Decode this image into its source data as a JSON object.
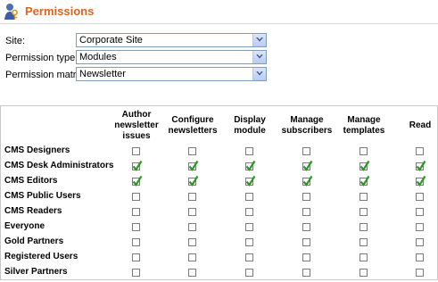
{
  "header": {
    "title": "Permissions"
  },
  "form": {
    "site_label": "Site:",
    "site_value": "Corporate Site",
    "permission_type_label": "Permission type:",
    "permission_type_value": "Modules",
    "permission_matrix_label": "Permission matrix:",
    "permission_matrix_value": "Newsletter"
  },
  "matrix": {
    "columns": [
      "Author newsletter issues",
      "Configure newsletters",
      "Display module",
      "Manage subscribers",
      "Manage templates",
      "Read"
    ],
    "rows": [
      {
        "label": "CMS Designers",
        "checked": [
          false,
          false,
          false,
          false,
          false,
          false
        ]
      },
      {
        "label": "CMS Desk Administrators",
        "checked": [
          true,
          true,
          true,
          true,
          true,
          true
        ]
      },
      {
        "label": "CMS Editors",
        "checked": [
          true,
          true,
          true,
          true,
          true,
          true
        ]
      },
      {
        "label": "CMS Public Users",
        "checked": [
          false,
          false,
          false,
          false,
          false,
          false
        ]
      },
      {
        "label": "CMS Readers",
        "checked": [
          false,
          false,
          false,
          false,
          false,
          false
        ]
      },
      {
        "label": "Everyone",
        "checked": [
          false,
          false,
          false,
          false,
          false,
          false
        ]
      },
      {
        "label": "Gold Partners",
        "checked": [
          false,
          false,
          false,
          false,
          false,
          false
        ]
      },
      {
        "label": "Registered Users",
        "checked": [
          false,
          false,
          false,
          false,
          false,
          false
        ]
      },
      {
        "label": "Silver Partners",
        "checked": [
          false,
          false,
          false,
          false,
          false,
          false
        ]
      }
    ]
  },
  "colors": {
    "title": "#e0631c",
    "check": "#2a9a22"
  },
  "icons": {
    "title_icon": "user-key-icon"
  }
}
